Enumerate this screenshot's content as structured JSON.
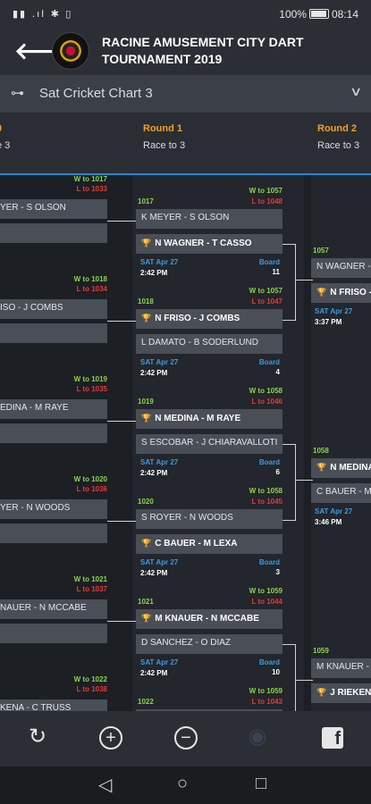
{
  "status": {
    "left_icons": "▮▮ .ıl ✱ ▯",
    "battery": "100%",
    "time": "08:14"
  },
  "header": {
    "title": "RACINE AMUSEMENT CITY DART TOURNAMENT 2019",
    "back_icon": "arrow-left-icon"
  },
  "chart_selector": {
    "value": "Sat Cricket Chart 3"
  },
  "rounds": [
    {
      "name": "0",
      "race": "e 3"
    },
    {
      "name": "Round 1",
      "race": "Race to 3"
    },
    {
      "name": "Round 2",
      "race": "Race to 3"
    }
  ],
  "round0": [
    {
      "w": "W to 1017",
      "l": "L to 1033",
      "top": "YER - S OLSON"
    },
    {
      "w": "W to 1018",
      "l": "L to 1034",
      "top": "ISO - J COMBS"
    },
    {
      "w": "W to 1019",
      "l": "L to 1035",
      "top": "EDINA - M RAYE"
    },
    {
      "w": "W to 1020",
      "l": "L to 1036",
      "top": "YER - N WOODS"
    },
    {
      "w": "W to 1021",
      "l": "L to 1037",
      "top": "NAUER - N MCCABE"
    },
    {
      "w": "W to 1022",
      "l": "L to 1038",
      "top": "KENA - C TRUSS"
    }
  ],
  "round1": [
    {
      "num": "1017",
      "w": "W to 1057",
      "l": "L to 1048",
      "top": "K MEYER - S OLSON",
      "bottom": "N WAGNER - T CASSO",
      "bottom_win": true,
      "date": "SAT Apr 27",
      "time": "2:42 PM",
      "board_label": "Board",
      "board": "11"
    },
    {
      "num": "1018",
      "w": "W to 1057",
      "l": "L to 1047",
      "top": "N FRISO - J COMBS",
      "top_win": true,
      "bottom": "L DAMATO - B SODERLUND",
      "date": "SAT Apr 27",
      "time": "2:42 PM",
      "board_label": "Board",
      "board": "4"
    },
    {
      "num": "1019",
      "w": "W to 1058",
      "l": "L to 1046",
      "top": "N MEDINA - M RAYE",
      "top_win": true,
      "bottom": "S ESCOBAR - J CHIARAVALLOTI",
      "date": "SAT Apr 27",
      "time": "2:42 PM",
      "board_label": "Board",
      "board": "6"
    },
    {
      "num": "1020",
      "w": "W to 1058",
      "l": "L to 1045",
      "top": "S ROYER - N WOODS",
      "bottom": "C BAUER - M LEXA",
      "bottom_win": true,
      "date": "SAT Apr 27",
      "time": "2:42 PM",
      "board_label": "Board",
      "board": "3"
    },
    {
      "num": "1021",
      "w": "W to 1059",
      "l": "L to 1044",
      "top": "M KNAUER - N MCCABE",
      "top_win": true,
      "bottom": "D SANCHEZ - O DIAZ",
      "date": "SAT Apr 27",
      "time": "2:42 PM",
      "board_label": "Board",
      "board": "10"
    },
    {
      "num": "1022",
      "w": "W to 1059",
      "l": "L to 1043",
      "top": "",
      "bottom": "",
      "date": "",
      "time": "",
      "board_label": "",
      "board": ""
    }
  ],
  "round2": [
    {
      "num": "1057",
      "top": "N WAGNER - T",
      "bottom": "N FRISO - J",
      "bottom_win": true,
      "date": "SAT Apr 27",
      "time": "3:37 PM"
    },
    {
      "num": "1058",
      "top": "N MEDINA - M",
      "top_win": true,
      "bottom": "C BAUER - M",
      "date": "SAT Apr 27",
      "time": "3:46 PM"
    },
    {
      "num": "1059",
      "top": "M KNAUER - N",
      "bottom": "J RIEKENA",
      "bottom_win": true,
      "date": "",
      "time": ""
    }
  ],
  "bottom_nav": {
    "refresh": "↻",
    "zoom_in": "+",
    "zoom_out": "−",
    "facebook": "f"
  },
  "system_nav": {
    "back": "◁",
    "home": "○",
    "recent": "□"
  }
}
